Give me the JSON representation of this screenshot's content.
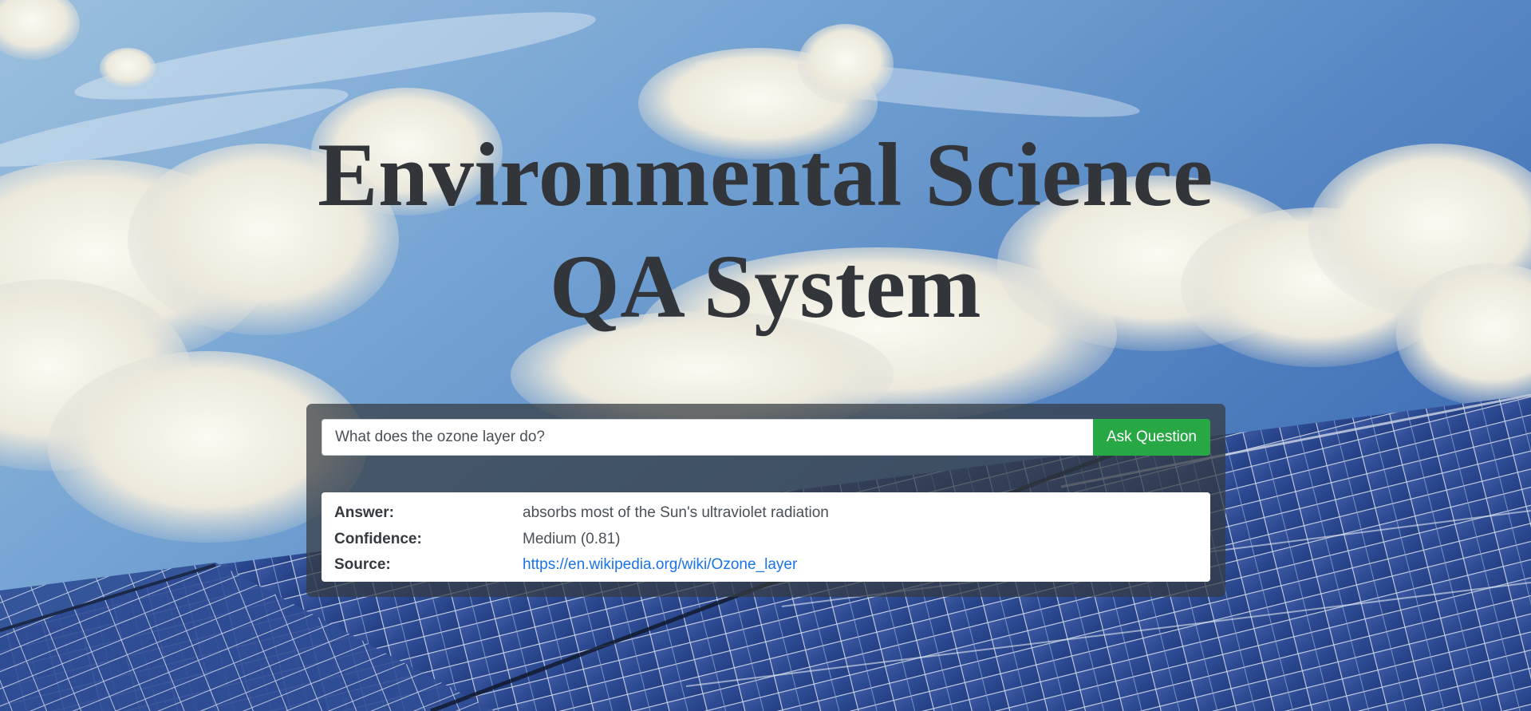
{
  "page": {
    "title_line1": "Environmental Science",
    "title_line2": "QA System"
  },
  "ask": {
    "input_value": "What does the ozone layer do?",
    "button_label": "Ask Question"
  },
  "result": {
    "rows": [
      {
        "label": "Answer:",
        "value": "absorbs most of the Sun's ultraviolet radiation",
        "is_link": false
      },
      {
        "label": "Confidence:",
        "value": "Medium (0.81)",
        "is_link": false
      },
      {
        "label": "Source:",
        "value": "https://en.wikipedia.org/wiki/Ozone_layer",
        "is_link": true
      }
    ]
  },
  "colors": {
    "button_green": "#28a745",
    "title_dark": "#32363b",
    "link_blue": "#1a73e8",
    "panel_overlay": "#343a40"
  },
  "background": {
    "description_icon": "sky-with-clouds-and-solar-panels"
  }
}
